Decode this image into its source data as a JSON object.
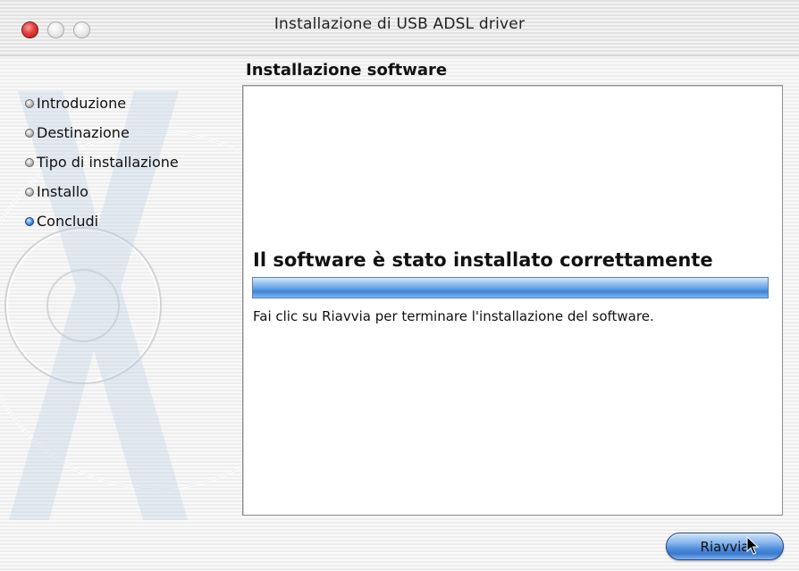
{
  "window": {
    "title": "Installazione di USB ADSL driver"
  },
  "sidebar": {
    "steps": [
      {
        "label": "Introduzione",
        "active": false
      },
      {
        "label": "Destinazione",
        "active": false
      },
      {
        "label": "Tipo di installazione",
        "active": false
      },
      {
        "label": "Installo",
        "active": false
      },
      {
        "label": "Concludi",
        "active": true
      }
    ]
  },
  "main": {
    "section_title": "Installazione software",
    "headline": "Il software è stato installato correttamente",
    "progress": 1.0,
    "instruction": "Fai clic su Riavvia per terminare l'installazione del software."
  },
  "buttons": {
    "restart_label": "Riavvia"
  },
  "icons": {
    "close": "close-traffic-light-icon",
    "minimize": "minimize-traffic-light-icon",
    "zoom": "zoom-traffic-light-icon",
    "pointer": "arrow-pointer-icon",
    "step_bullet": "step-bullet-icon",
    "background": "mac-os-x-logo-watermark"
  },
  "colors": {
    "accent_blue": "#3e84d6",
    "close_red": "#e0403a"
  }
}
